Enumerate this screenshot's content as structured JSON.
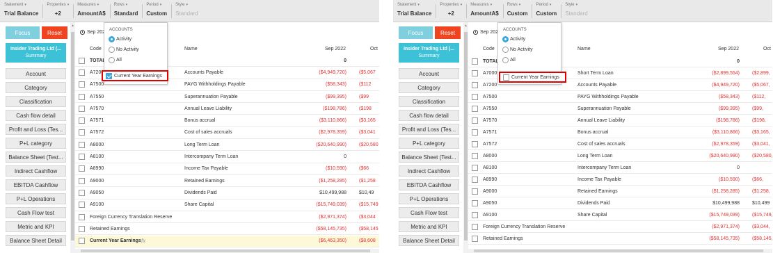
{
  "panels": [
    {
      "toolbar": {
        "statement": {
          "label": "Statement",
          "value": "Trial Balance"
        },
        "properties": {
          "label": "Properties",
          "value": "+2"
        },
        "measures": {
          "label": "Measures",
          "value": "AmountA$"
        },
        "rows": {
          "label": "Rows",
          "value": "Standard"
        },
        "period": {
          "label": "Period",
          "value": "Custom"
        },
        "style": {
          "label": "Style",
          "value": "Standard"
        }
      },
      "sidebar": {
        "focus": "Focus",
        "reset": "Reset",
        "company_name": "Insider Trading Ltd (...",
        "company_sub": "Summary",
        "items": [
          "Account",
          "Category",
          "Classification",
          "Cash flow detail",
          "Profit and Loss (Tes...",
          "P+L category",
          "Balance Sheet (Test...",
          "Indirect Cashflow",
          "EBITDA Cashflow",
          "P+L Operations",
          "Cash Flow test",
          "Metric and KPI",
          "Balance Sheet Detail"
        ]
      },
      "period_label": "Sep 2022",
      "columns": {
        "code": "Code",
        "name": "Name",
        "p1": "Sep 2022",
        "p2": "Oct"
      },
      "dropdown": {
        "title": "ACCOUNTS",
        "options": [
          "Activity",
          "No Activity",
          "All"
        ],
        "selected": "Activity",
        "cye_label": "Current Year Earnings",
        "cye_checked": true
      },
      "rows": [
        {
          "code": "TOTAL",
          "name": "",
          "v1": "0",
          "v2": "",
          "total": true
        },
        {
          "code": "A7200",
          "name": "Accounts Payable",
          "v1": "($4,949,720)",
          "v2": "($5,067"
        },
        {
          "code": "A7500",
          "name": "PAYG Withholdings Payable",
          "v1": "($58,343)",
          "v2": "($112"
        },
        {
          "code": "A7550",
          "name": "Superannuation Payable",
          "v1": "($99,395)",
          "v2": "($99"
        },
        {
          "code": "A7570",
          "name": "Annual Leave Liability",
          "v1": "($198,786)",
          "v2": "($198"
        },
        {
          "code": "A7571",
          "name": "Bonus accrual",
          "v1": "($3,110,866)",
          "v2": "($3,165"
        },
        {
          "code": "A7572",
          "name": "Cost of sales accruals",
          "v1": "($2,978,359)",
          "v2": "($3,041"
        },
        {
          "code": "A8000",
          "name": "Long Term Loan",
          "v1": "($20,640,990)",
          "v2": "($20,580"
        },
        {
          "code": "A8100",
          "name": "Intercompany Term Loan",
          "v1": "0",
          "v2": ""
        },
        {
          "code": "A8990",
          "name": "Income Tax Payable",
          "v1": "($10,590)",
          "v2": "($66"
        },
        {
          "code": "A9000",
          "name": "Retained Earnings",
          "v1": "($1,258,285)",
          "v2": "($1,258"
        },
        {
          "code": "A9050",
          "name": "Dividends Paid",
          "v1": "$10,499,988",
          "v2": "$10,49"
        },
        {
          "code": "A9100",
          "name": "Share Capital",
          "v1": "($15,749,039)",
          "v2": "($15,749"
        },
        {
          "code": "Foreign Currency Translation Reserve",
          "name": "",
          "v1": "($2,971,374)",
          "v2": "($3,044"
        },
        {
          "code": "Retained Earnings",
          "name": "",
          "v1": "($58,145,735)",
          "v2": "($58,145"
        },
        {
          "code": "Current Year Earnings",
          "name": "fx",
          "v1": "($6,463,350)",
          "v2": "($8,608"
        }
      ]
    },
    {
      "toolbar": {
        "statement": {
          "label": "Statement",
          "value": "Trial Balance"
        },
        "properties": {
          "label": "Properties",
          "value": "+2"
        },
        "measures": {
          "label": "Measures",
          "value": "AmountA$"
        },
        "rows": {
          "label": "Rows",
          "value": "Custom"
        },
        "period": {
          "label": "Period",
          "value": "Custom"
        },
        "style": {
          "label": "Style",
          "value": "Standard"
        }
      },
      "sidebar": {
        "focus": "Focus",
        "reset": "Reset",
        "company_name": "Insider Trading Ltd (...",
        "company_sub": "Summary",
        "items": [
          "Account",
          "Category",
          "Classification",
          "Cash flow detail",
          "Profit and Loss (Tes...",
          "P+L category",
          "Balance Sheet (Test...",
          "Indirect Cashflow",
          "EBITDA Cashflow",
          "P+L Operations",
          "Cash Flow test",
          "Metric and KPI",
          "Balance Sheet Detail"
        ]
      },
      "period_label": "Sep 2022",
      "columns": {
        "code": "Code",
        "name": "Name",
        "p1": "Sep 2022",
        "p2": "Oct 2"
      },
      "dropdown": {
        "title": "ACCOUNTS",
        "options": [
          "Activity",
          "No Activity",
          "All"
        ],
        "selected": "Activity",
        "cye_label": "Current Year Earnings",
        "cye_checked": false
      },
      "rows": [
        {
          "code": "TOTAL",
          "name": "",
          "v1": "0",
          "v2": "",
          "total": true
        },
        {
          "code": "A7000",
          "name": "Short Term Loan",
          "v1": "($2,899,554)",
          "v2": "($2,899,"
        },
        {
          "code": "A7200",
          "name": "Accounts Payable",
          "v1": "($4,949,720)",
          "v2": "($5,067,"
        },
        {
          "code": "A7500",
          "name": "PAYG Withholdings Payable",
          "v1": "($58,343)",
          "v2": "($112,"
        },
        {
          "code": "A7550",
          "name": "Superannuation Payable",
          "v1": "($99,395)",
          "v2": "($99,"
        },
        {
          "code": "A7570",
          "name": "Annual Leave Liability",
          "v1": "($198,786)",
          "v2": "($198,"
        },
        {
          "code": "A7571",
          "name": "Bonus accrual",
          "v1": "($3,110,866)",
          "v2": "($3,165,"
        },
        {
          "code": "A7572",
          "name": "Cost of sales accruals",
          "v1": "($2,978,359)",
          "v2": "($3,041,"
        },
        {
          "code": "A8000",
          "name": "Long Term Loan",
          "v1": "($20,640,990)",
          "v2": "($20,580,"
        },
        {
          "code": "A8100",
          "name": "Intercompany Term Loan",
          "v1": "0",
          "v2": ""
        },
        {
          "code": "A8990",
          "name": "Income Tax Payable",
          "v1": "($10,590)",
          "v2": "($66,"
        },
        {
          "code": "A9000",
          "name": "Retained Earnings",
          "v1": "($1,258,285)",
          "v2": "($1,258,"
        },
        {
          "code": "A9050",
          "name": "Dividends Paid",
          "v1": "$10,499,988",
          "v2": "$10,499"
        },
        {
          "code": "A9100",
          "name": "Share Capital",
          "v1": "($15,749,039)",
          "v2": "($15,749,"
        },
        {
          "code": "Foreign Currency Translation Reserve",
          "name": "",
          "v1": "($2,971,374)",
          "v2": "($3,044,"
        },
        {
          "code": "Retained Earnings",
          "name": "",
          "v1": "($58,145,735)",
          "v2": "($58,145,"
        }
      ]
    }
  ]
}
